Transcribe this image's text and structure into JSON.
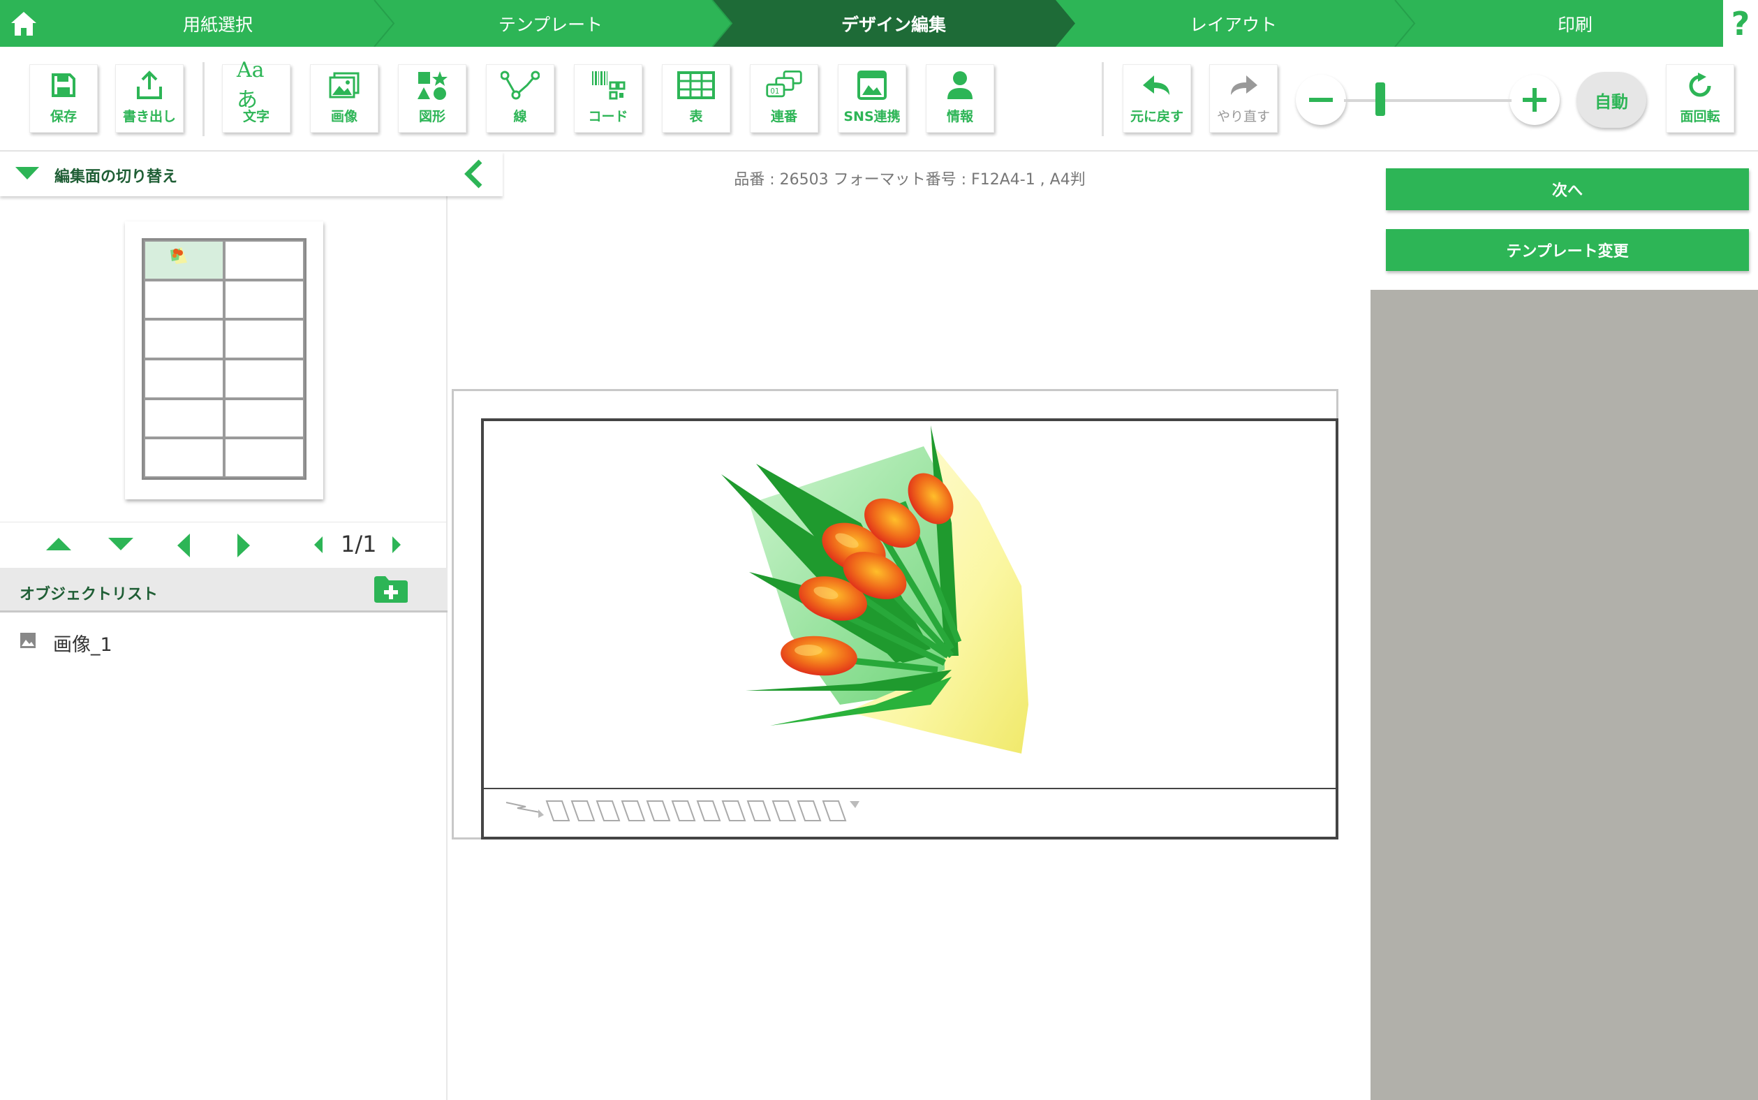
{
  "steps": [
    {
      "label": "用紙選択",
      "active": false
    },
    {
      "label": "テンプレート",
      "active": false
    },
    {
      "label": "デザイン編集",
      "active": true
    },
    {
      "label": "レイアウト",
      "active": false
    },
    {
      "label": "印刷",
      "active": false
    }
  ],
  "help_label": "?",
  "toolbar": {
    "save": "保存",
    "export": "書き出し",
    "text_icon": "Aaあ",
    "text": "文字",
    "image": "画像",
    "shape": "図形",
    "line": "線",
    "code": "コード",
    "table": "表",
    "serial": "連番",
    "sns": "SNS連携",
    "info": "情報",
    "undo": "元に戻す",
    "redo": "やり直す",
    "auto": "自動",
    "rotate": "面回転"
  },
  "zoom": {
    "level_fraction": 0.2
  },
  "left_panel": {
    "switch_title": "編集面の切り替え",
    "page_count": "1/1",
    "objlist_title": "オブジェクトリスト",
    "objects": [
      {
        "name": "画像_1",
        "icon": "image-icon"
      }
    ]
  },
  "canvas": {
    "product_info": "品番 : 26503 フォーマット番号 : F12A4-1 , A4判"
  },
  "right_panel": {
    "next": "次へ",
    "change_template": "テンプレート変更"
  },
  "colors": {
    "brand_green": "#2db556",
    "active_step": "#1e6b37",
    "gray_panel": "#b1b0aa"
  }
}
